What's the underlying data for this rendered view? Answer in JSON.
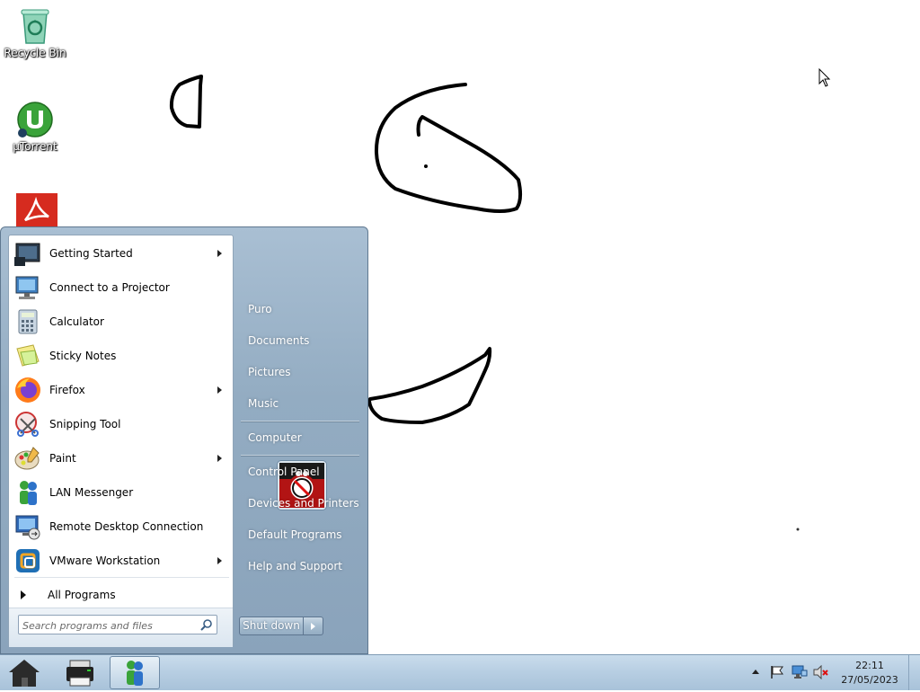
{
  "desktop": {
    "icons": [
      {
        "label": "Recycle Bin",
        "icon": "recycle-bin-icon"
      },
      {
        "label": "µTorrent",
        "icon": "utorrent-icon"
      },
      {
        "label": "",
        "icon": "adobe-reader-icon"
      }
    ]
  },
  "start_menu": {
    "programs": [
      {
        "label": "Getting Started",
        "has_submenu": true
      },
      {
        "label": "Connect to a Projector",
        "has_submenu": false
      },
      {
        "label": "Calculator",
        "has_submenu": false
      },
      {
        "label": "Sticky Notes",
        "has_submenu": false
      },
      {
        "label": "Firefox",
        "has_submenu": true
      },
      {
        "label": "Snipping Tool",
        "has_submenu": false
      },
      {
        "label": "Paint",
        "has_submenu": true
      },
      {
        "label": "LAN Messenger",
        "has_submenu": false
      },
      {
        "label": "Remote Desktop Connection",
        "has_submenu": false
      },
      {
        "label": "VMware Workstation",
        "has_submenu": true
      }
    ],
    "all_programs_label": "All Programs",
    "search_placeholder": "Search programs and files",
    "right_items": {
      "user": "Puro",
      "documents": "Documents",
      "pictures": "Pictures",
      "music": "Music",
      "computer": "Computer",
      "control_panel": "Control Panel",
      "devices_printers": "Devices and Printers",
      "default_programs": "Default Programs",
      "help_support": "Help and Support"
    },
    "shutdown_label": "Shut down"
  },
  "taskbar": {
    "pinned": [
      "home-icon",
      "printer-icon",
      "lan-messenger-icon"
    ],
    "tray_icons": [
      "show-hidden-icons-arrow",
      "action-center-flag-icon",
      "network-icon",
      "volume-muted-icon"
    ],
    "time": "22:11",
    "date": "27/05/2023"
  },
  "colors": {
    "start_menu_right": "#93acc2",
    "taskbar": "#b8cfe3"
  }
}
